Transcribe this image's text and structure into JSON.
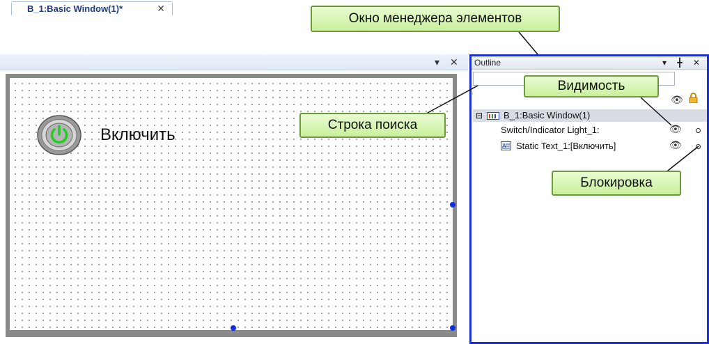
{
  "editor": {
    "tab_label": "B_1:Basic Window(1)*",
    "tab_close": "✕",
    "pin_icon": "▾",
    "close_icon": "✕",
    "static_text": "Включить"
  },
  "outline": {
    "title": "Outline",
    "header_icons": "▾ ╋ ✕",
    "search_value": "",
    "tree": {
      "root_toggle": "⊟",
      "root_label": "B_1:Basic Window(1)",
      "items": [
        {
          "label": "Switch/Indicator Light_1:"
        },
        {
          "label": "Static Text_1:[Включить]"
        }
      ]
    }
  },
  "callouts": {
    "manager": "Окно менеджера элементов",
    "visibility": "Видимость",
    "search": "Строка поиска",
    "lock": "Блокировка"
  },
  "colors": {
    "outline_border": "#1a2fd6",
    "callout_fill": "#d4f5ad",
    "power_green": "#22cc22",
    "handle_blue": "#1030e0"
  },
  "icons": {
    "visibility": "eye-icon",
    "lock": "padlock-icon",
    "power": "power-icon"
  }
}
